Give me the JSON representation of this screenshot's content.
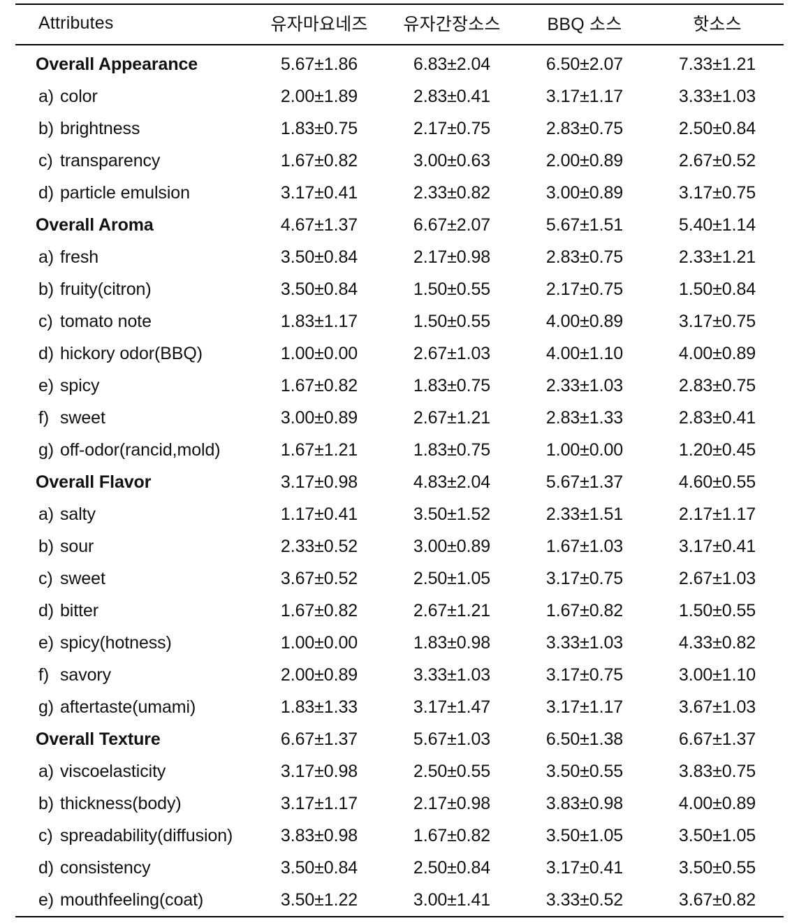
{
  "table": {
    "columns": [
      {
        "key": "attribute",
        "label": "Attributes",
        "align": "left"
      },
      {
        "key": "yuja_mayo",
        "label": "유자마요네즈",
        "align": "center"
      },
      {
        "key": "yuja_soy",
        "label": "유자간장소스",
        "align": "center"
      },
      {
        "key": "bbq",
        "label": "BBQ 소스",
        "align": "center"
      },
      {
        "key": "hot",
        "label": "핫소스",
        "align": "center"
      }
    ],
    "rows": [
      {
        "type": "group",
        "letter": "",
        "attribute": "Overall  Appearance",
        "values": [
          "5.67±1.86",
          "6.83±2.04",
          "6.50±2.07",
          "7.33±1.21"
        ]
      },
      {
        "type": "item",
        "letter": "a)",
        "attribute": "color",
        "values": [
          "2.00±1.89",
          "2.83±0.41",
          "3.17±1.17",
          "3.33±1.03"
        ]
      },
      {
        "type": "item",
        "letter": "b)",
        "attribute": "brightness",
        "values": [
          "1.83±0.75",
          "2.17±0.75",
          "2.83±0.75",
          "2.50±0.84"
        ]
      },
      {
        "type": "item",
        "letter": "c)",
        "attribute": "transparency",
        "values": [
          "1.67±0.82",
          "3.00±0.63",
          "2.00±0.89",
          "2.67±0.52"
        ]
      },
      {
        "type": "item",
        "letter": "d)",
        "attribute": "particle  emulsion",
        "values": [
          "3.17±0.41",
          "2.33±0.82",
          "3.00±0.89",
          "3.17±0.75"
        ]
      },
      {
        "type": "group",
        "letter": "",
        "attribute": "Overall  Aroma",
        "values": [
          "4.67±1.37",
          "6.67±2.07",
          "5.67±1.51",
          "5.40±1.14"
        ]
      },
      {
        "type": "item",
        "letter": "a)",
        "attribute": "fresh",
        "values": [
          "3.50±0.84",
          "2.17±0.98",
          "2.83±0.75",
          "2.33±1.21"
        ]
      },
      {
        "type": "item",
        "letter": "b)",
        "attribute": "fruity(citron)",
        "values": [
          "3.50±0.84",
          "1.50±0.55",
          "2.17±0.75",
          "1.50±0.84"
        ]
      },
      {
        "type": "item",
        "letter": "c)",
        "attribute": "tomato  note",
        "values": [
          "1.83±1.17",
          "1.50±0.55",
          "4.00±0.89",
          "3.17±0.75"
        ]
      },
      {
        "type": "item",
        "letter": "d)",
        "attribute": "hickory  odor(BBQ)",
        "values": [
          "1.00±0.00",
          "2.67±1.03",
          "4.00±1.10",
          "4.00±0.89"
        ]
      },
      {
        "type": "item",
        "letter": "e)",
        "attribute": "spicy",
        "values": [
          "1.67±0.82",
          "1.83±0.75",
          "2.33±1.03",
          "2.83±0.75"
        ]
      },
      {
        "type": "item",
        "letter": "f)",
        "attribute": "sweet",
        "values": [
          "3.00±0.89",
          "2.67±1.21",
          "2.83±1.33",
          "2.83±0.41"
        ]
      },
      {
        "type": "item",
        "letter": "g)",
        "attribute": "off-odor(rancid,mold)",
        "values": [
          "1.67±1.21",
          "1.83±0.75",
          "1.00±0.00",
          "1.20±0.45"
        ]
      },
      {
        "type": "group",
        "letter": "",
        "attribute": "Overall  Flavor",
        "values": [
          "3.17±0.98",
          "4.83±2.04",
          "5.67±1.37",
          "4.60±0.55"
        ]
      },
      {
        "type": "item",
        "letter": "a)",
        "attribute": "salty",
        "values": [
          "1.17±0.41",
          "3.50±1.52",
          "2.33±1.51",
          "2.17±1.17"
        ]
      },
      {
        "type": "item",
        "letter": "b)",
        "attribute": "sour",
        "values": [
          "2.33±0.52",
          "3.00±0.89",
          "1.67±1.03",
          "3.17±0.41"
        ]
      },
      {
        "type": "item",
        "letter": "c)",
        "attribute": "sweet",
        "values": [
          "3.67±0.52",
          "2.50±1.05",
          "3.17±0.75",
          "2.67±1.03"
        ]
      },
      {
        "type": "item",
        "letter": "d)",
        "attribute": "bitter",
        "values": [
          "1.67±0.82",
          "2.67±1.21",
          "1.67±0.82",
          "1.50±0.55"
        ]
      },
      {
        "type": "item",
        "letter": "e)",
        "attribute": "spicy(hotness)",
        "values": [
          "1.00±0.00",
          "1.83±0.98",
          "3.33±1.03",
          "4.33±0.82"
        ]
      },
      {
        "type": "item",
        "letter": "f)",
        "attribute": "savory",
        "values": [
          "2.00±0.89",
          "3.33±1.03",
          "3.17±0.75",
          "3.00±1.10"
        ]
      },
      {
        "type": "item",
        "letter": "g)",
        "attribute": "aftertaste(umami)",
        "values": [
          "1.83±1.33",
          "3.17±1.47",
          "3.17±1.17",
          "3.67±1.03"
        ]
      },
      {
        "type": "group",
        "letter": "",
        "attribute": "Overall  Texture",
        "values": [
          "6.67±1.37",
          "5.67±1.03",
          "6.50±1.38",
          "6.67±1.37"
        ]
      },
      {
        "type": "item",
        "letter": "a)",
        "attribute": "viscoelasticity",
        "values": [
          "3.17±0.98",
          "2.50±0.55",
          "3.50±0.55",
          "3.83±0.75"
        ]
      },
      {
        "type": "item",
        "letter": "b)",
        "attribute": "thickness(body)",
        "values": [
          "3.17±1.17",
          "2.17±0.98",
          "3.83±0.98",
          "4.00±0.89"
        ]
      },
      {
        "type": "item",
        "letter": "c)",
        "attribute": "spreadability(diffusion)",
        "values": [
          "3.83±0.98",
          "1.67±0.82",
          "3.50±1.05",
          "3.50±1.05"
        ]
      },
      {
        "type": "item",
        "letter": "d)",
        "attribute": "consistency",
        "values": [
          "3.50±0.84",
          "2.50±0.84",
          "3.17±0.41",
          "3.50±0.55"
        ]
      },
      {
        "type": "item",
        "letter": "e)",
        "attribute": "mouthfeeling(coat)",
        "values": [
          "3.50±1.22",
          "3.00±1.41",
          "3.33±0.52",
          "3.67±0.82"
        ]
      }
    ]
  }
}
